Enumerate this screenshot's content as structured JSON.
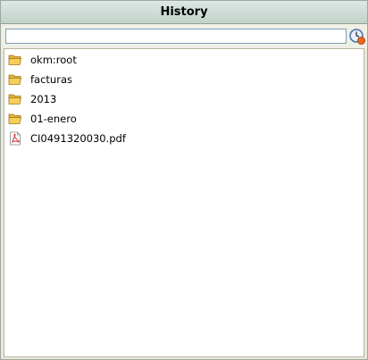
{
  "panel": {
    "title": "History"
  },
  "search": {
    "value": "",
    "placeholder": ""
  },
  "items": [
    {
      "label": "okm:root",
      "icon": "folder-open-icon"
    },
    {
      "label": "facturas",
      "icon": "folder-open-icon"
    },
    {
      "label": "2013",
      "icon": "folder-open-icon"
    },
    {
      "label": "01-enero",
      "icon": "folder-open-icon"
    },
    {
      "label": "CI0491320030.pdf",
      "icon": "pdf-file-icon"
    }
  ],
  "colors": {
    "title_bar": "#c8d6cf",
    "folder": "#f2c44a",
    "pdf": "#d32f2f"
  }
}
